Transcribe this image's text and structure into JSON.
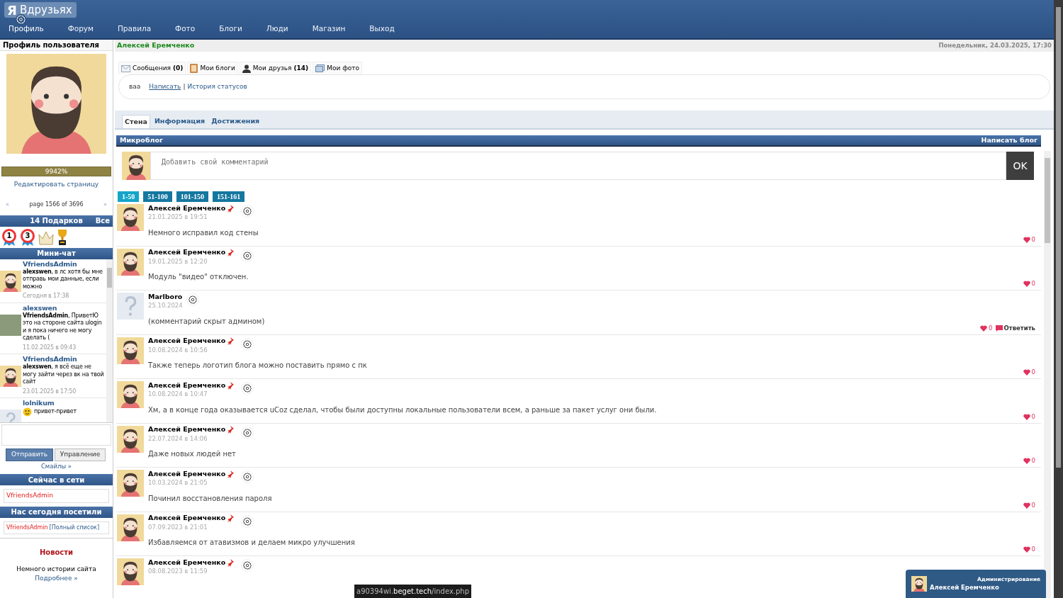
{
  "header": {
    "logo_letter": "Я",
    "logo_text": "Вдрузьях",
    "nav": [
      {
        "label": "Профиль",
        "selected": true
      },
      {
        "label": "Форум",
        "selected": false
      },
      {
        "label": "Правила",
        "selected": false
      },
      {
        "label": "Фото",
        "selected": false
      },
      {
        "label": "Блоги",
        "selected": false
      },
      {
        "label": "Люди",
        "selected": false
      },
      {
        "label": "Магазин",
        "selected": false
      },
      {
        "label": "Выход",
        "selected": false
      }
    ]
  },
  "sidebar": {
    "title": "Профиль пользователя",
    "progress": {
      "level": 1,
      "label": "9942%"
    },
    "edit_link": "Редактировать страницу",
    "pager": {
      "prev": "«",
      "label": "page 1566 of 3696",
      "next": "»"
    },
    "gifts": {
      "title": "14 Подарков",
      "all": "Все",
      "items": [
        {
          "kind": "medal",
          "label": "1"
        },
        {
          "kind": "medal",
          "label": "3"
        },
        {
          "kind": "crown"
        },
        {
          "kind": "trophy"
        }
      ]
    },
    "minichat": {
      "title": "Мини-чат",
      "messages": [
        {
          "kind": "beard",
          "author": "VfriendsAdmin",
          "text": "**alexswen**, в лс хотя бы мне отправь мои данные, если можно",
          "date": "Сегодня в 17:38",
          "smiley": false
        },
        {
          "kind": "photo",
          "author": "alexswen",
          "text": "**VfriendsAdmin**, ПриветЮ это на стороне сайта ulogin и я пока ничего не могу сделать (",
          "date": "11.02.2025 в 09:43",
          "smiley": false
        },
        {
          "kind": "beard",
          "author": "VfriendsAdmin",
          "text": "**alexswen**, я всё еще не могу зайти через вк на твой сайт",
          "date": "23.01.2025 в 17:50",
          "smiley": false
        },
        {
          "kind": "unknown",
          "author": "lolnikum",
          "text": "привет-привет",
          "smiley": true
        }
      ],
      "send": "Отправить",
      "manage": "Управление",
      "smileys": "Смайлы »"
    },
    "online": {
      "title": "Сейчас в сети",
      "users": [
        "VfriendsAdmin"
      ]
    },
    "visited": {
      "title": "Нас сегодня посетили",
      "users": [
        "VfriendsAdmin"
      ],
      "full_list": "[Полный список]"
    },
    "news": {
      "title": "Новости",
      "text": "Немного истории сайта",
      "more": "Подробнее »"
    }
  },
  "main": {
    "user_name": "Алексей Еремченко",
    "date": "Понедельник, 24.03.2025, 17:30",
    "profile_tabs": [
      {
        "kind": "mail",
        "label": "Сообщения",
        "count": "(0)"
      },
      {
        "kind": "blog",
        "label": "Мои блоги"
      },
      {
        "kind": "friends",
        "label": "Мои друзья",
        "count": "(14)"
      },
      {
        "kind": "photo",
        "label": "Мои фото"
      }
    ],
    "status": {
      "text": "ваа",
      "write": "Написать",
      "separator": "|",
      "history": "История статусов"
    },
    "section_tabs": [
      {
        "label": "Стена",
        "selected": true
      },
      {
        "label": "Информация",
        "selected": false
      },
      {
        "label": "Достижения",
        "selected": false
      }
    ],
    "microblog": {
      "title": "Микроблог",
      "write_blog": "Написать блог",
      "comment_placeholder": "Добавить свой комментарий",
      "ok": "OK",
      "pages": [
        {
          "label": "1-50",
          "selected": true
        },
        {
          "label": "51-100",
          "selected": false
        },
        {
          "label": "101-150",
          "selected": false
        },
        {
          "label": "151-161",
          "selected": false
        }
      ],
      "posts": [
        {
          "kind": "beard",
          "author": "Алексей Еремченко",
          "pinned": true,
          "date": "21.01.2025 в 19:51",
          "text": "Немного исправил код стены",
          "likes": "0"
        },
        {
          "kind": "beard",
          "author": "Алексей Еремченко",
          "pinned": true,
          "date": "19.01.2025 в 12:20",
          "text": "Модуль \"видео\" отключен.",
          "likes": "0"
        },
        {
          "kind": "unknown",
          "author": "Marlboro",
          "pinned": false,
          "date": "25.10.2024",
          "text": "(комментарий скрыт админом)",
          "likes": "0",
          "reply": "Ответить"
        },
        {
          "kind": "beard",
          "author": "Алексей Еремченко",
          "pinned": true,
          "date": "10.08.2024 в 10:56",
          "text": "Также теперь логотип блога можно поставить прямо с пк",
          "likes": "0"
        },
        {
          "kind": "beard",
          "author": "Алексей Еремченко",
          "pinned": true,
          "date": "10.08.2024 в 10:47",
          "text": "Хм, а в конце года оказывается uCoz сделал, чтобы были доступны локальные пользователи всем, а раньше за пакет услуг они были.",
          "likes": "0"
        },
        {
          "kind": "beard",
          "author": "Алексей Еремченко",
          "pinned": true,
          "date": "22.07.2024 в 14:06",
          "text": "Даже новых людей нет",
          "likes": "0"
        },
        {
          "kind": "beard",
          "author": "Алексей Еремченко",
          "pinned": true,
          "date": "10.03.2024 в 21:05",
          "text": "Починил восстановления пароля",
          "likes": "0"
        },
        {
          "kind": "beard",
          "author": "Алексей Еремченко",
          "pinned": true,
          "date": "07.09.2023 в 21:01",
          "text": "Избавляемся от атавизмов и делаем микро улучшения",
          "likes": "0"
        },
        {
          "kind": "beard",
          "author": "Алексей Еремченко",
          "pinned": true,
          "date": "08.08.2023 в 11:59"
        }
      ]
    }
  },
  "status_bar": {
    "url_prefix": "a90394wi.",
    "url_host": "beget.tech",
    "url_path": "/index.php"
  },
  "admin_widget": {
    "title": "Администрирование",
    "name": "Алексей Еремченко"
  }
}
